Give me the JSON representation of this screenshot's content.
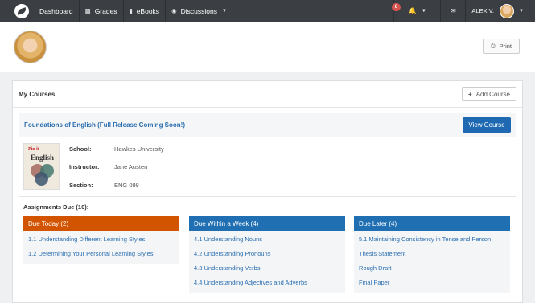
{
  "nav": {
    "dashboard": "Dashboard",
    "grades": "Grades",
    "ebooks": "eBooks",
    "discussions": "Discussions",
    "notification_count": "8",
    "user_name": "ALEX V."
  },
  "profile": {
    "print_label": "Print"
  },
  "courses": {
    "title": "My Courses",
    "add_label": "Add Course",
    "course": {
      "title": "Foundations of English (Full Release Coming Soon!)",
      "view_label": "View Course",
      "cover_brand": "Pin it",
      "cover_title": "English",
      "school_label": "School:",
      "school": "Hawkes University",
      "instructor_label": "Instructor:",
      "instructor": "Jane Austen",
      "section_label": "Section:",
      "section": "ENG 098"
    },
    "assignments_title": "Assignments Due (10):",
    "columns": [
      {
        "title": "Due Today (2)",
        "color": "#d35400",
        "items": [
          "1.1 Understanding Different Learning Styles",
          "1.2 Determining Your Personal Learning Styles"
        ]
      },
      {
        "title": "Due Within a Week (4)",
        "color": "#1f6fb2",
        "items": [
          "4.1 Understanding Nouns",
          "4.2 Understanding Pronouns",
          "4.3 Understanding Verbs",
          "4.4 Understanding Adjectives and Adverbs"
        ]
      },
      {
        "title": "Due Later (4)",
        "color": "#1f6fb2",
        "items": [
          "5.1 Maintaining Consistency in Tense and Person",
          "Thesis Statement",
          "Rough Draft",
          "Final Paper"
        ]
      }
    ]
  }
}
